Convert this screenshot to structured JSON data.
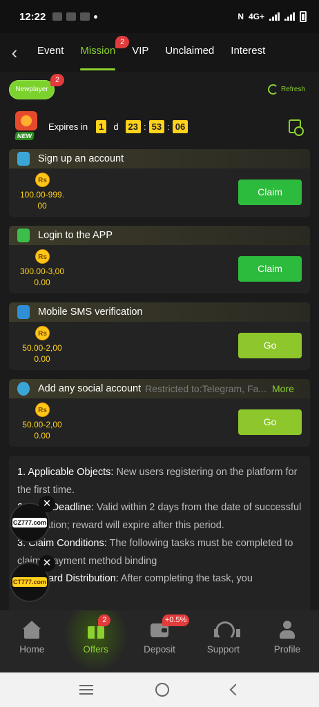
{
  "status_bar": {
    "time": "12:22",
    "network": "4G+"
  },
  "tabs": {
    "back_label": "‹",
    "items": [
      {
        "label": "Event"
      },
      {
        "label": "Mission",
        "badge": "2"
      },
      {
        "label": "VIP"
      },
      {
        "label": "Unclaimed"
      },
      {
        "label": "Interest"
      }
    ]
  },
  "subheader": {
    "newplayer_label": "Newplayer",
    "newplayer_badge": "2",
    "refresh_label": "Refresh",
    "new_icon_label": "NEW",
    "expires_label": "Expires in",
    "days": "1",
    "day_unit": "d",
    "hours": "23",
    "minutes": "53",
    "seconds": "06",
    "time_sep": ":"
  },
  "tasks": [
    {
      "title": "Sign up an account",
      "coin": "Rs",
      "amount": "100.00-999.\n00",
      "button": "Claim"
    },
    {
      "title": "Login to the APP",
      "coin": "Rs",
      "amount": "300.00-3,00\n0.00",
      "button": "Claim"
    },
    {
      "title": "Mobile SMS verification",
      "coin": "Rs",
      "amount": "50.00-2,00\n0.00",
      "button": "Go"
    },
    {
      "title": "Add any social account",
      "restriction": "Restricted to:Telegram, Fa...",
      "more": "More",
      "coin": "Rs",
      "amount": "50.00-2,00\n0.00",
      "button": "Go"
    }
  ],
  "rules": [
    {
      "heading": "1. Applicable Objects:",
      "text": " New users registering on the platform for the first time."
    },
    {
      "heading": "2. Task Deadline:",
      "text": " Valid within 2 days from the date of successful registration; reward will expire after this period."
    },
    {
      "heading": "3. Claim Conditions:",
      "text": " The following tasks must be completed to claim: Payment method binding"
    },
    {
      "heading": "4. Reward Distribution:",
      "text": " After completing the task, you"
    }
  ],
  "floating_ads": [
    {
      "logo": "CZ777.com",
      "close": "✕"
    },
    {
      "logo": "CT777.com",
      "close": "✕"
    }
  ],
  "bottom_nav": [
    {
      "label": "Home",
      "icon": "home-icon"
    },
    {
      "label": "Offers",
      "icon": "gift-icon",
      "badge": "2"
    },
    {
      "label": "Deposit",
      "icon": "wallet-icon",
      "badge": "+0.5%"
    },
    {
      "label": "Support",
      "icon": "headset-icon"
    },
    {
      "label": "Profile",
      "icon": "user-icon"
    }
  ],
  "colors": {
    "accent": "#8cd12f",
    "claim_button": "#2dbb3d",
    "go_button": "#8ec72b",
    "coin": "#ffc61a",
    "badge": "#e23b3b"
  }
}
